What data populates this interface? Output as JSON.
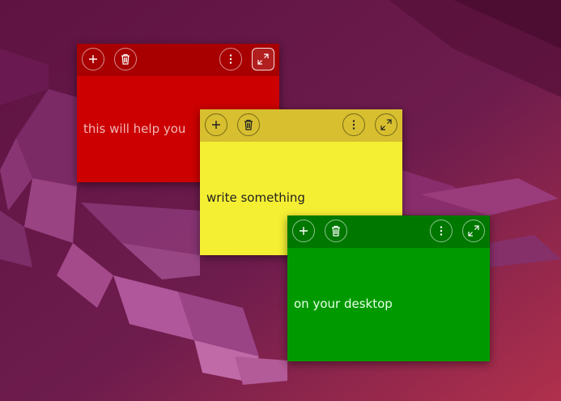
{
  "colors": {
    "red_body": "#cc0000",
    "red_bar": "#a80000",
    "yellow_body": "#f5ef33",
    "yellow_bar": "#d8bf2f",
    "green_body": "#009a00",
    "green_bar": "#007800",
    "red_text": "#f0b8b8",
    "yellow_text": "#222222",
    "green_text": "#e8ffe8"
  },
  "notes": [
    {
      "id": "red",
      "text": "this will help you",
      "icons": [
        "plus-icon",
        "trash-icon",
        "more-vertical-icon",
        "expand-icon"
      ]
    },
    {
      "id": "yellow",
      "text": "write something",
      "icons": [
        "plus-icon",
        "trash-icon",
        "more-vertical-icon",
        "expand-icon"
      ]
    },
    {
      "id": "green",
      "text": "on your desktop",
      "icons": [
        "plus-icon",
        "trash-icon",
        "more-vertical-icon",
        "expand-icon"
      ]
    }
  ]
}
